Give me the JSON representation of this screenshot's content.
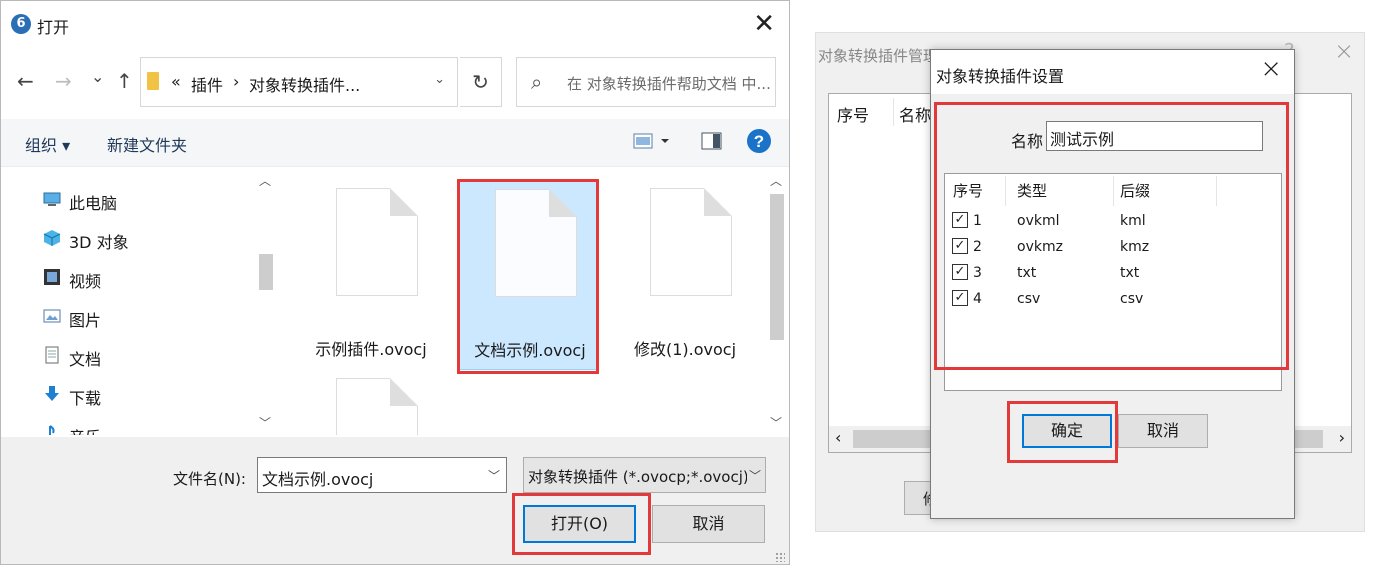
{
  "open_dialog": {
    "title": "打开",
    "app_icon_glyph": "6",
    "nav": {
      "back": "←",
      "forward": "→",
      "recent": "⌄",
      "up": "↑"
    },
    "address": {
      "crumbs": [
        "«",
        "插件",
        "›",
        "对象转换插件..."
      ],
      "dropdown": "⌄",
      "refresh": "↻"
    },
    "search_placeholder": "在 对象转换插件帮助文档 中...",
    "toolbar": {
      "organize": "组织 ▾",
      "new_folder": "新建文件夹",
      "help": "?"
    },
    "nav_items": [
      {
        "label": "此电脑",
        "icon": "computer-icon"
      },
      {
        "label": "3D 对象",
        "icon": "3d-objects-icon"
      },
      {
        "label": "视频",
        "icon": "video-icon"
      },
      {
        "label": "图片",
        "icon": "pictures-icon"
      },
      {
        "label": "文档",
        "icon": "documents-icon"
      },
      {
        "label": "下载",
        "icon": "download-icon"
      },
      {
        "label": "音乐",
        "icon": "music-icon"
      }
    ],
    "files": [
      "示例插件.ovocj",
      "文档示例.ovocj",
      "修改(1).ovocj",
      ""
    ],
    "selected_file": "文档示例.ovocj",
    "filename_label": "文件名(N):",
    "filename_value": "文档示例.ovocj",
    "filter_value": "对象转换插件 (*.ovocp;*.ovocj)",
    "open_button": "打开(O)",
    "cancel_button": "取消",
    "arrows": {
      "up": "︿",
      "down": "﹀"
    }
  },
  "manager": {
    "title": "对象转换插件管理",
    "help": "?",
    "close": "×",
    "columns": [
      "序号",
      "名称"
    ],
    "button_fragment": "修",
    "scroll_left": "‹",
    "scroll_right": "›"
  },
  "settings": {
    "title": "对象转换插件设置",
    "close": "×",
    "name_label": "名称",
    "name_value": "测试示例",
    "columns": [
      "序号",
      "类型",
      "后缀"
    ],
    "rows": [
      {
        "checked": true,
        "index": "1",
        "type": "ovkml",
        "suffix": "kml"
      },
      {
        "checked": true,
        "index": "2",
        "type": "ovkmz",
        "suffix": "kmz"
      },
      {
        "checked": true,
        "index": "3",
        "type": "txt",
        "suffix": "txt"
      },
      {
        "checked": true,
        "index": "4",
        "type": "csv",
        "suffix": "csv"
      }
    ],
    "checkmark": "✓",
    "ok_button": "确定",
    "cancel_button": "取消"
  },
  "colors": {
    "highlight": "#e23a3a",
    "selection": "#cce8ff",
    "focus": "#0078d7"
  }
}
